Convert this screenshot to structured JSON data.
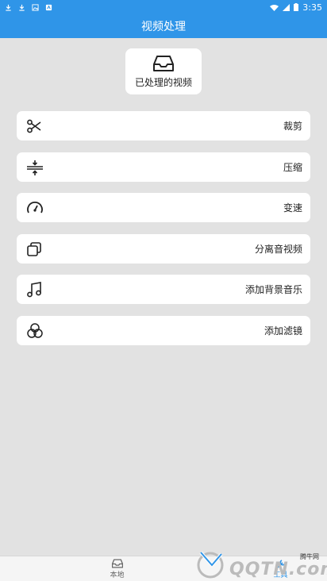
{
  "status_bar": {
    "time": "3:35",
    "icons": [
      "download-icon",
      "download-icon",
      "image-icon",
      "android-icon",
      "wifi-icon",
      "signal-icon",
      "battery-icon"
    ]
  },
  "app_bar": {
    "title": "视频处理"
  },
  "processed_button": {
    "label": "已处理的视频",
    "icon": "inbox-icon"
  },
  "items": [
    {
      "label": "裁剪",
      "icon": "scissors-icon"
    },
    {
      "label": "压缩",
      "icon": "compress-icon"
    },
    {
      "label": "变速",
      "icon": "speedometer-icon"
    },
    {
      "label": "分离音视频",
      "icon": "copy-icon"
    },
    {
      "label": "添加背景音乐",
      "icon": "music-icon"
    },
    {
      "label": "添加滤镜",
      "icon": "filter-icon"
    }
  ],
  "bottom_nav": [
    {
      "label": "本地",
      "icon": "inbox-icon",
      "active": false
    },
    {
      "label": "工具",
      "icon": "tool-icon",
      "active": true
    }
  ],
  "watermark": {
    "text": "QQTN.com",
    "top_text": "腾牛网"
  },
  "colors": {
    "accent": "#2f95e8",
    "background": "#e2e2e2",
    "card": "#ffffff"
  }
}
